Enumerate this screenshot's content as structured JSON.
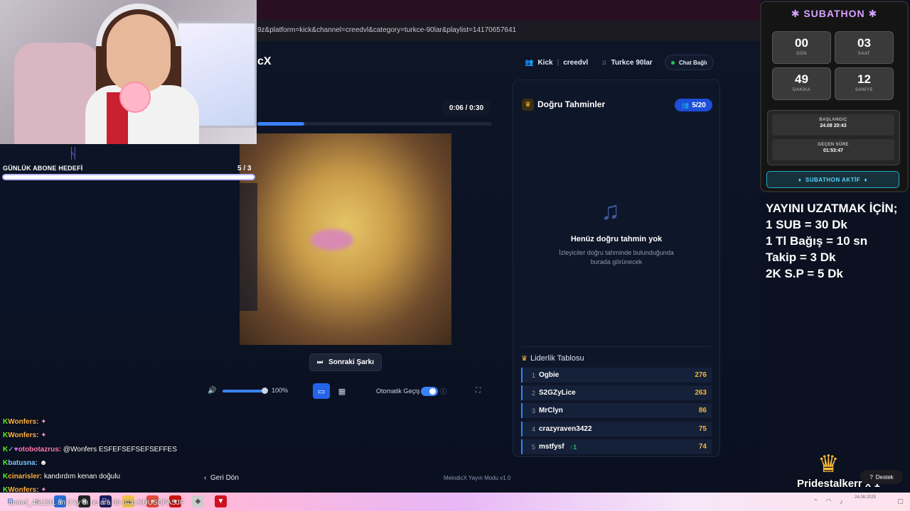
{
  "browser": {
    "url": "9z&platform=kick&channel=creedvl&category=turkce-90lar&playlist=14170657641"
  },
  "sub_goal": {
    "label": "GÜNLÜK ABONE HEDEFİ",
    "count": "5 / 3",
    "progress": 1.0
  },
  "chat": [
    {
      "user": "Wonfers:",
      "message": ""
    },
    {
      "user": "Wonfers:",
      "message": ""
    },
    {
      "user": "otobotazrus:",
      "message": "@Wonfers ESFEFSEFSEFSEFFES"
    },
    {
      "user": "batusna:",
      "message": ""
    },
    {
      "user": "cinarisler:",
      "message": "kandırdım kenan doğulu"
    },
    {
      "user": "Wonfers:",
      "message": ""
    }
  ],
  "app": {
    "logo": "cX",
    "platform": "Kick",
    "channel": "creedvl",
    "category": "Turkce 90lar",
    "chat_status": "Chat Bağlı"
  },
  "player": {
    "time": "0:06 / 0:30",
    "progress": 0.2,
    "next_label": "Sonraki Şarkı",
    "volume": "100%",
    "volume_level": 1.0,
    "auto_label": "Otomatik Geçiş",
    "auto_enabled": true
  },
  "guesses": {
    "title": "Doğru Tahminler",
    "count": "5/20",
    "empty_title": "Henüz doğru tahmin yok",
    "empty_desc": "İzleyiciler doğru tahminde bulunduğunda burada görünecek"
  },
  "leaderboard": {
    "title": "Liderlik Tablosu",
    "rows": [
      {
        "rank": "1",
        "name": "Ogbie",
        "score": "276",
        "trend": ""
      },
      {
        "rank": "2",
        "name": "S2GZyLice",
        "score": "263",
        "trend": ""
      },
      {
        "rank": "3",
        "name": "MrClyn",
        "score": "86",
        "trend": ""
      },
      {
        "rank": "4",
        "name": "crazyraven3422",
        "score": "75",
        "trend": ""
      },
      {
        "rank": "5",
        "name": "mstfysf",
        "score": "74",
        "trend": "↑1"
      }
    ]
  },
  "footer": {
    "back": "Geri Dön",
    "version": "MelodicX Yayın Modu v1.0"
  },
  "subathon": {
    "title": "SUBATHON",
    "days": "00",
    "days_label": "GÜN",
    "hours": "03",
    "hours_label": "SAAT",
    "minutes": "49",
    "minutes_label": "DAKİKA",
    "seconds": "12",
    "seconds_label": "SANİYE",
    "start_label": "BAŞLANGIÇ",
    "start_value": "24.08 20:43",
    "elapsed_label": "GEÇEN SÜRE",
    "elapsed_value": "01:53:47",
    "active_label": "SUBATHON AKTİF"
  },
  "extend": {
    "line1": "YAYINI UZATMAK İÇİN;",
    "line2": "1 SUB = 30 Dk",
    "line3": "1 Tl Bağış = 10 sn",
    "line4": "Takip = 3 Dk",
    "line5": "2K S.P = 5 Dk"
  },
  "alert": {
    "text": "Pridestalkerr x 1",
    "support": "Destek"
  },
  "taskbar": {
    "ticker": "anmel_451231 an 3 ky dı ne ara 86 oldu KDUSDFASJF",
    "date": "24.08.2025"
  },
  "colors": {
    "accent": "#3b82f6",
    "score": "#f5b83a",
    "kick_green": "#53fc18",
    "subathon_title": "#d7a2ff"
  }
}
